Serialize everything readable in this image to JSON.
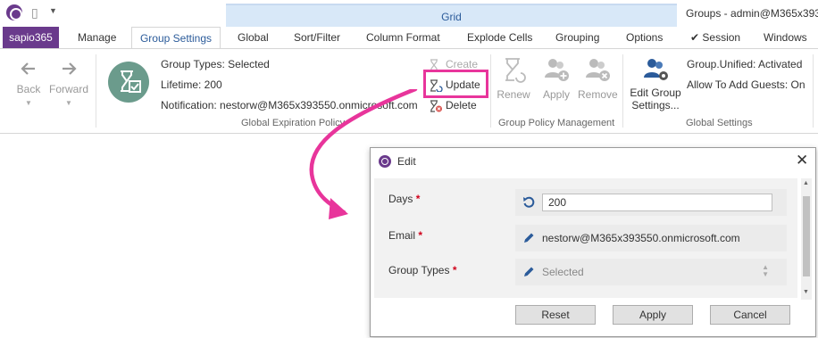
{
  "titlebar": {
    "context_tab": "Grid",
    "window_title": "Groups - admin@M365x393550"
  },
  "tabs": [
    {
      "label": "sapio365"
    },
    {
      "label": "Manage"
    },
    {
      "label": "Group Settings"
    },
    {
      "label": "Global"
    },
    {
      "label": "Sort/Filter"
    },
    {
      "label": "Column Format"
    },
    {
      "label": "Explode Cells"
    },
    {
      "label": "Grouping"
    },
    {
      "label": "Options"
    },
    {
      "label": "Session"
    },
    {
      "label": "Windows"
    }
  ],
  "ribbon": {
    "back": "Back",
    "forward": "Forward",
    "expiration": {
      "group_types": "Group Types: Selected",
      "lifetime": "Lifetime: 200",
      "notification": "Notification: nestorw@M365x393550.onmicrosoft.com",
      "group_label": "Global Expiration Policy"
    },
    "create": "Create",
    "update": "Update",
    "delete": "Delete",
    "renew": "Renew",
    "apply": "Apply",
    "remove": "Remove",
    "policy_group_label": "Group Policy Management",
    "edit_settings_line1": "Edit Group",
    "edit_settings_line2": "Settings...",
    "unified_status": "Group.Unified: Activated",
    "allow_guests": "Allow To Add Guests: On",
    "settings_group_label": "Global Settings"
  },
  "dialog": {
    "title": "Edit",
    "fields": {
      "days_label": "Days",
      "days_value": "200",
      "email_label": "Email",
      "email_value": "nestorw@M365x393550.onmicrosoft.com",
      "group_types_label": "Group Types",
      "group_types_value": "Selected",
      "required_mark": "*"
    },
    "buttons": {
      "reset": "Reset",
      "apply": "Apply",
      "cancel": "Cancel"
    }
  },
  "colors": {
    "brand": "#6a3a8c",
    "accent": "#2b5b9a",
    "highlight": "#e8359b",
    "required": "#d0021b"
  }
}
